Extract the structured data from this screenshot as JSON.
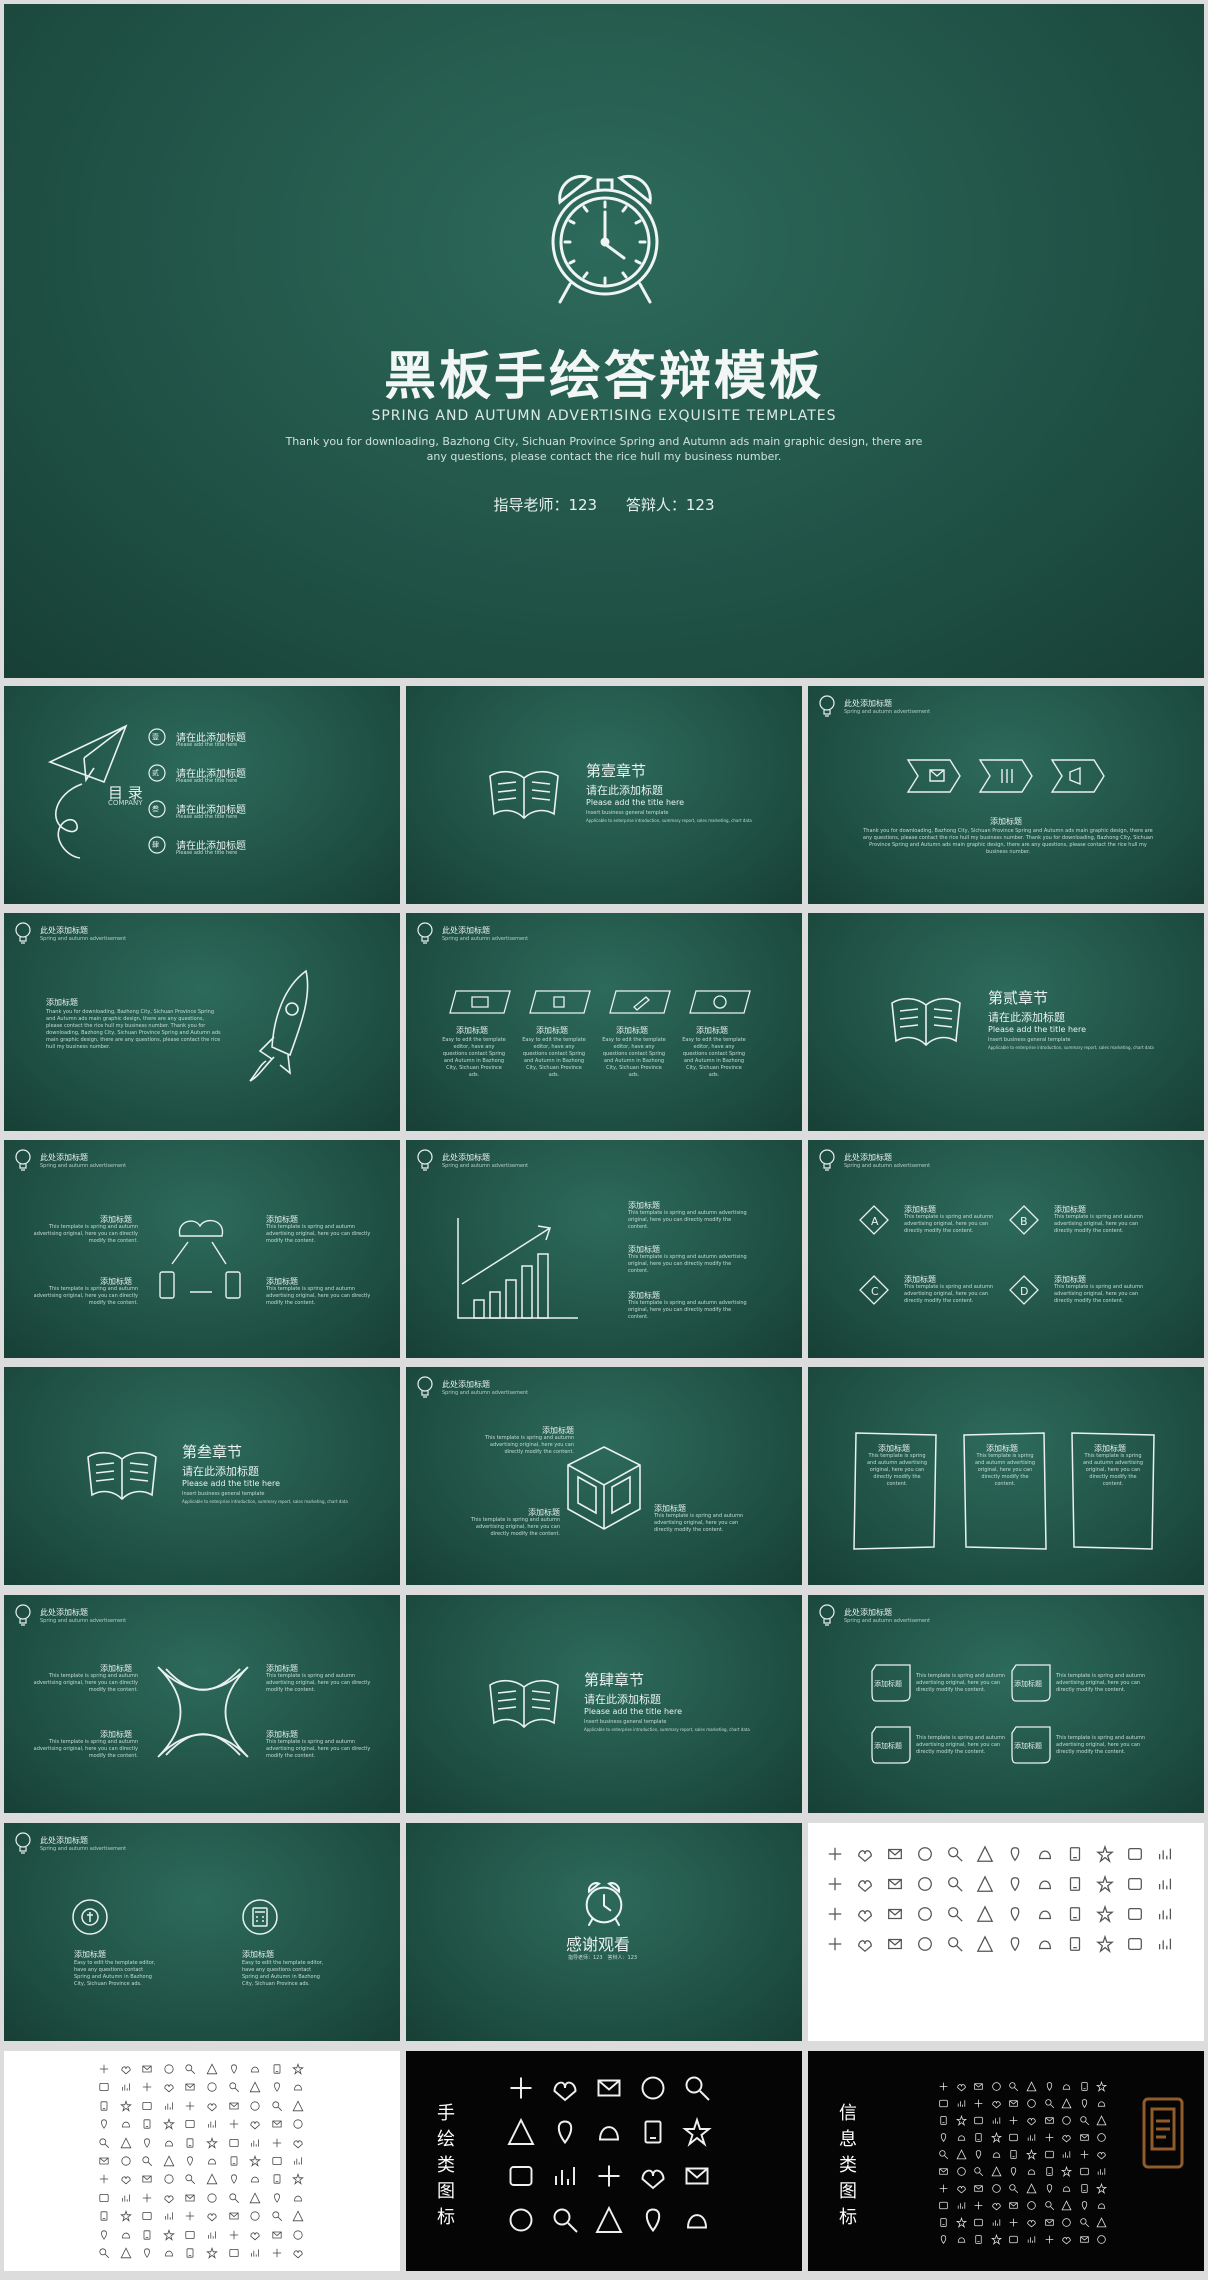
{
  "hero": {
    "title": "黑板手绘答辩模板",
    "subtitle": "SPRING AND AUTUMN ADVERTISING EXQUISITE TEMPLATES",
    "description": "Thank you for downloading, Bazhong City, Sichuan Province Spring and Autumn ads main graphic design, there are any questions, please contact the rice hull my business number.",
    "advisor": "指导老师：123",
    "defender": "答辩人：123"
  },
  "common": {
    "header_title": "此处添加标题",
    "header_sub": "Spring and autumn advertisement",
    "add_title": "添加标题",
    "body_text": "This template is spring and autumn advertising original, here you can directly modify the content.",
    "chapter_sub_title": "请在此添加标题",
    "chapter_sub_en": "Please add the title here",
    "chapter_note": "Insert business general template",
    "chapter_note2": "Applicable to enterprise introduction, summary report, sales marketing, chart data"
  },
  "toc": {
    "title": "目 录",
    "company": "COMPANY",
    "items": [
      {
        "num": "壹",
        "label": "请在此添加标题",
        "sub": "Please add the title here"
      },
      {
        "num": "贰",
        "label": "请在此添加标题",
        "sub": "Please add the title here"
      },
      {
        "num": "叁",
        "label": "请在此添加标题",
        "sub": "Please add the title here"
      },
      {
        "num": "肆",
        "label": "请在此添加标题",
        "sub": "Please add the title here"
      }
    ]
  },
  "chapters": [
    "第壹章节",
    "第贰章节",
    "第叁章节",
    "第肆章节"
  ],
  "slide4": {
    "label": "添加标题",
    "text": "Thank you for downloading, Bazhong City, Sichuan Province Spring and Autumn ads main graphic design, there are any questions, please contact the rice hull my business number. Thank you for downloading, Bazhong City, Sichuan Province Spring and Autumn ads main graphic design, there are any questions, please contact the rice hull my business number."
  },
  "slide5": {
    "text": "Easy to edit the template editor, have any questions contact Spring and Autumn in Bazhong City, Sichuan Province ads."
  },
  "slide9": {
    "letters": [
      "A",
      "B",
      "C",
      "D"
    ]
  },
  "thanks": {
    "title": "感谢观看",
    "meta": "指导老师：123　答辩人：123"
  },
  "icon_pages": {
    "hand_drawn": "手绘类图标",
    "info": "信息类图标"
  },
  "colors": {
    "chalkboard": "#215447",
    "chalk": "#e9f1ee",
    "page_bg": "#dcdcdc"
  }
}
